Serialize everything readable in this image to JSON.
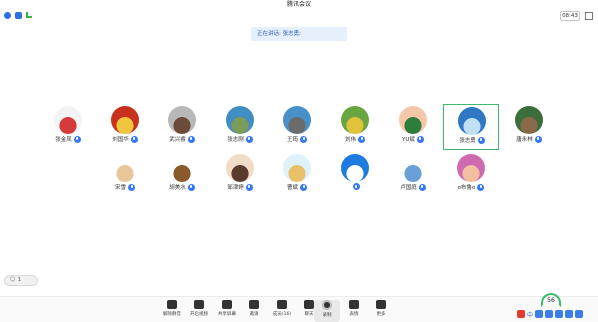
{
  "window": {
    "title": "腾讯会议"
  },
  "status": {
    "clock": "08:43",
    "speaking": "正在讲话: 张志勇;"
  },
  "participants_row1": [
    {
      "name": "张金凤",
      "color": "#f4f4f4",
      "accent": "#d63b3b"
    },
    {
      "name": "刘国华",
      "color": "#c9311f",
      "accent": "#f2c541"
    },
    {
      "name": "武兴睿",
      "color": "#b8b8b8",
      "accent": "#6c4b3a"
    },
    {
      "name": "张志刚",
      "color": "#3f8fc4",
      "accent": "#7c9a5a"
    },
    {
      "name": "王筠",
      "color": "#4a90c8",
      "accent": "#6b6b6b"
    },
    {
      "name": "刘伟",
      "color": "#6aa640",
      "accent": "#e0c23d"
    },
    {
      "name": "YU斌",
      "color": "#f6c6a8",
      "accent": "#2d7c3a"
    },
    {
      "name": "张志勇",
      "color": "#2e78c4",
      "accent": "#bfe0f5"
    },
    {
      "name": "唐永林",
      "color": "#3b6e3b",
      "accent": "#8a6a4a"
    }
  ],
  "participants_row2": [
    {
      "name": "宋雪",
      "color": "#ffffff",
      "accent": "#e7c69a"
    },
    {
      "name": "胡美水",
      "color": "#ffffff",
      "accent": "#8a5a2b"
    },
    {
      "name": "邹津婷",
      "color": "#f2dcc8",
      "accent": "#5a3a2a"
    },
    {
      "name": "曹斌",
      "color": "#dff1fb",
      "accent": "#e9c16a"
    },
    {
      "name": "",
      "color": "#1e7be0",
      "accent": "#ffffff"
    },
    {
      "name": "卢国庭",
      "color": "#ffffff",
      "accent": "#6aa0d8"
    },
    {
      "name": "o布鲁o",
      "color": "#d06ab0",
      "accent": "#f2c0a0"
    }
  ],
  "chat_toggle": "🗨 1",
  "toolbar": [
    {
      "label": "解除静音",
      "id": "unmute"
    },
    {
      "label": "开启视频",
      "id": "video"
    },
    {
      "label": "共享屏幕",
      "id": "share"
    },
    {
      "label": "邀请",
      "id": "invite"
    },
    {
      "label": "成员(16)",
      "id": "members"
    },
    {
      "label": "聊天",
      "id": "chat"
    },
    {
      "label": "录制",
      "id": "record"
    },
    {
      "label": "表情",
      "id": "emoji"
    },
    {
      "label": "更多",
      "id": "more"
    }
  ],
  "system": {
    "cpu": "56",
    "tray_lang": "中"
  }
}
